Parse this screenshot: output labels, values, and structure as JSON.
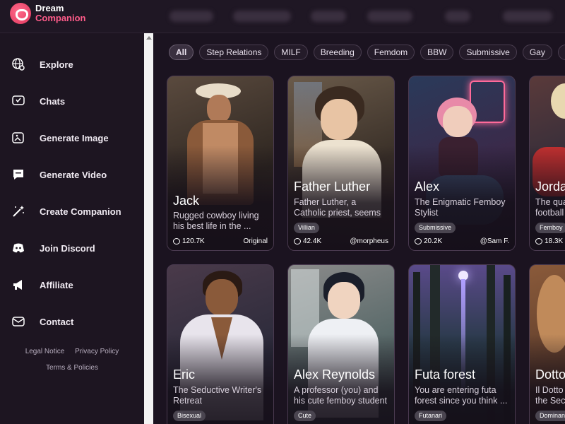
{
  "app": {
    "name_line1": "Dream",
    "name_line2": "Companion"
  },
  "sidebar": {
    "items": [
      {
        "label": "Explore",
        "icon": "globe-search-icon"
      },
      {
        "label": "Chats",
        "icon": "chat-heart-icon"
      },
      {
        "label": "Generate Image",
        "icon": "image-edit-icon"
      },
      {
        "label": "Generate Video",
        "icon": "video-chat-icon"
      },
      {
        "label": "Create Companion",
        "icon": "magic-wand-icon"
      },
      {
        "label": "Join Discord",
        "icon": "discord-icon"
      },
      {
        "label": "Affiliate",
        "icon": "megaphone-icon"
      },
      {
        "label": "Contact",
        "icon": "mail-heart-icon"
      }
    ],
    "footer": {
      "legal": "Legal Notice",
      "privacy": "Privacy Policy",
      "terms": "Terms & Policies"
    }
  },
  "filters": [
    "All",
    "Step Relations",
    "MILF",
    "Breeding",
    "Femdom",
    "BBW",
    "Submissive",
    "Gay",
    "Cheat"
  ],
  "cards": [
    {
      "name": "Jack",
      "desc": "Rugged cowboy living his best life in the ...",
      "tag": "",
      "chats": "120.7K",
      "creator": "Original"
    },
    {
      "name": "Father Luther",
      "desc": "Father Luther, a Catholic priest, seems attentiv...",
      "tag": "Villian",
      "chats": "42.4K",
      "creator": "@morpheus"
    },
    {
      "name": "Alex",
      "desc": "The Enigmatic Femboy Stylist",
      "tag": "Submissive",
      "chats": "20.2K",
      "creator": "@Sam F."
    },
    {
      "name": "Jorda",
      "desc": "The qua football",
      "tag": "Femboy",
      "chats": "18.3K",
      "creator": ""
    },
    {
      "name": "Eric",
      "desc": "The Seductive Writer's Retreat",
      "tag": "Bisexual",
      "chats": "",
      "creator": ""
    },
    {
      "name": "Alex Reynolds",
      "desc": "A professor (you) and his cute femboy student ...",
      "tag": "Cute",
      "chats": "",
      "creator": ""
    },
    {
      "name": "Futa forest",
      "desc": "You are entering futa forest since you think ...",
      "tag": "Futanari",
      "chats": "",
      "creator": ""
    },
    {
      "name": "Dotto",
      "desc": "Il Dotto the Sec",
      "tag": "Dominan",
      "chats": "",
      "creator": ""
    }
  ],
  "colors": {
    "accent": "#ff5c8a",
    "background": "#1b1320",
    "sidebar": "#1d1521"
  }
}
